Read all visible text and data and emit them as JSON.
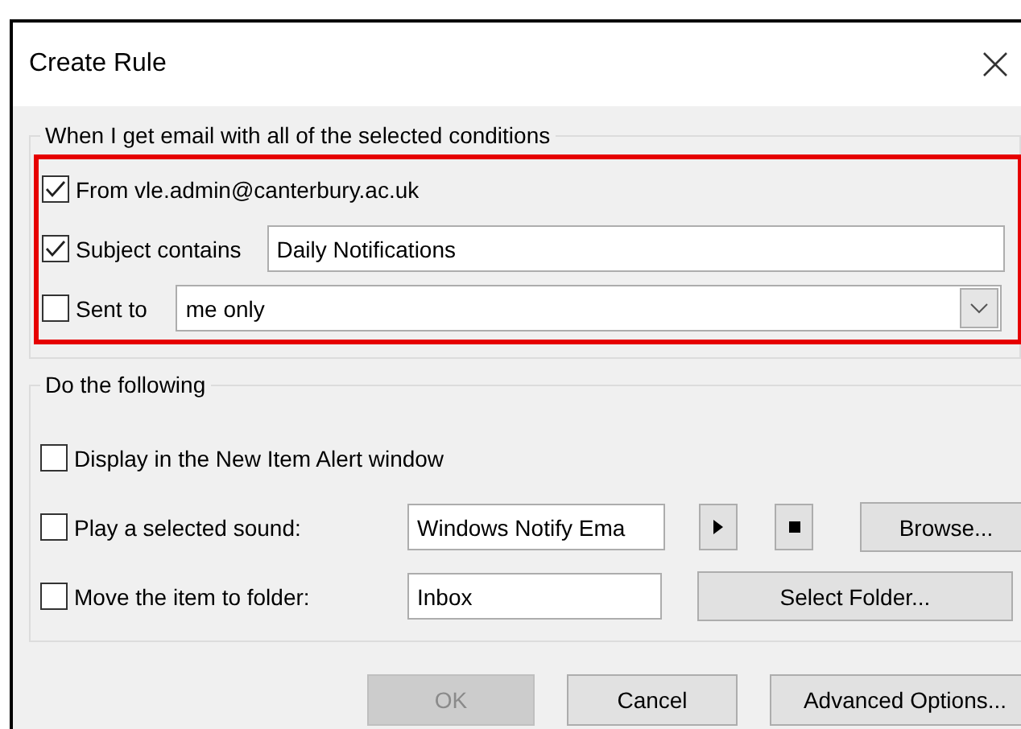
{
  "window": {
    "title": "Create Rule"
  },
  "conditions": {
    "legend": "When I get email with all of the selected conditions",
    "highlighted": true,
    "items": [
      {
        "kind": "check",
        "label": "From vle.admin@canterbury.ac.uk",
        "checked": true
      },
      {
        "kind": "text",
        "label": "Subject contains",
        "checked": true,
        "value": "Daily Notifications"
      },
      {
        "kind": "select",
        "label": "Sent to",
        "checked": false,
        "value": "me only"
      }
    ]
  },
  "actions": {
    "legend": "Do the following",
    "items": [
      {
        "kind": "check",
        "label": "Display in the New Item Alert window",
        "checked": false
      },
      {
        "kind": "sound",
        "label": "Play a selected sound:",
        "checked": false,
        "value": "Windows Notify Ema",
        "button": "Browse..."
      },
      {
        "kind": "folder",
        "label": "Move the item to folder:",
        "checked": false,
        "value": "Inbox",
        "button": "Select Folder..."
      }
    ]
  },
  "buttons": [
    {
      "label": "OK",
      "disabled": true
    },
    {
      "label": "Cancel",
      "disabled": false
    },
    {
      "label": "Advanced Options...",
      "disabled": false
    }
  ]
}
